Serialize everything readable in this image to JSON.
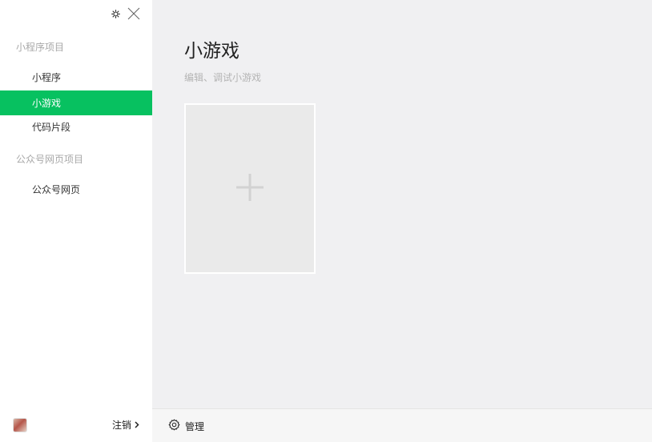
{
  "sidebar": {
    "icons": [
      "settings-icon",
      "close-icon"
    ],
    "section1_title": "小程序项目",
    "items1": [
      {
        "label": "小程序",
        "active": false
      },
      {
        "label": "小游戏",
        "active": true
      },
      {
        "label": "代码片段",
        "active": false
      }
    ],
    "section2_title": "公众号网页项目",
    "items2": [
      {
        "label": "公众号网页",
        "active": false
      }
    ],
    "footer": {
      "logout_label": "注销"
    }
  },
  "main": {
    "title": "小游戏",
    "subtitle": "编辑、调试小游戏",
    "create_card_icon": "plus-icon"
  },
  "footer": {
    "manage_label": "管理",
    "manage_icon": "gear-icon"
  },
  "colors": {
    "accent": "#07c160",
    "main_bg": "#f0f0f2",
    "card_bg": "#eaeaea"
  }
}
